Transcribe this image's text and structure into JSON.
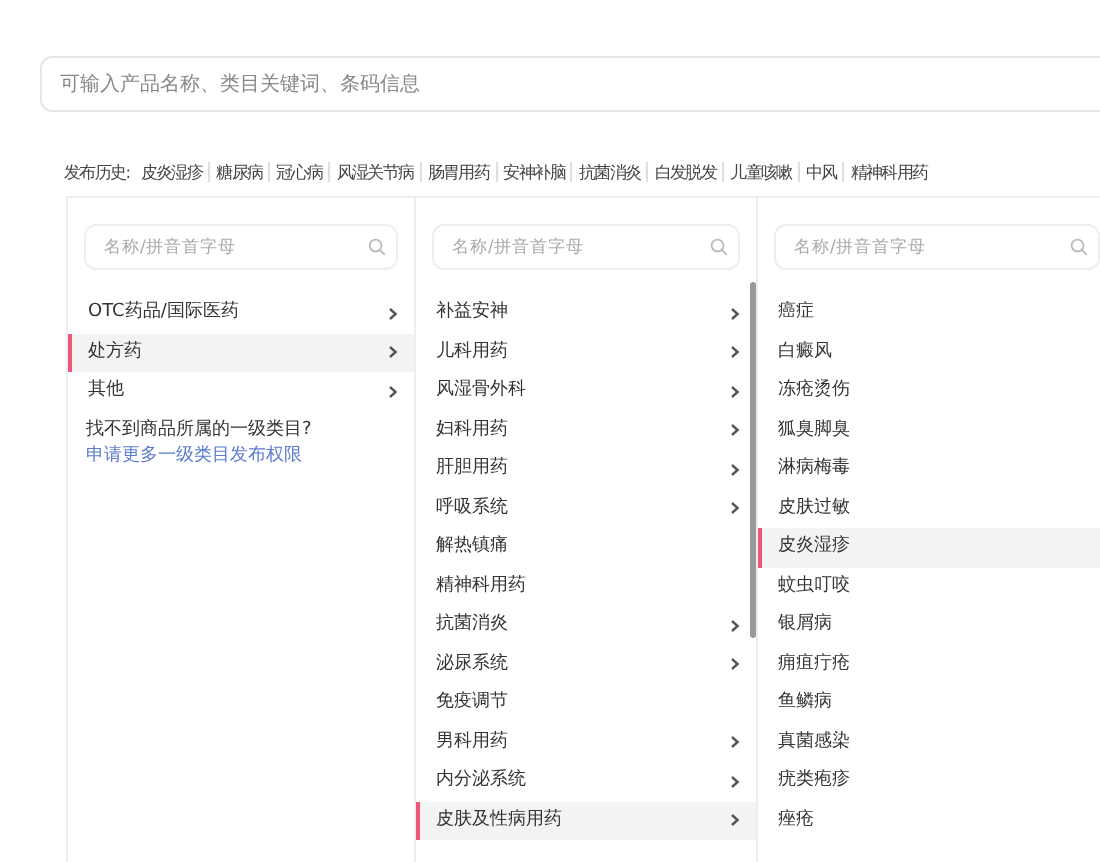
{
  "search": {
    "placeholder": "可输入产品名称、类目关键词、条码信息"
  },
  "history": {
    "label": "发布历史:",
    "items": [
      "皮炎湿疹",
      "糖尿病",
      "冠心病",
      "风湿关节病",
      "肠胃用药",
      "安神补脑",
      "抗菌消炎",
      "白发脱发",
      "儿童咳嗽",
      "中风",
      "精神科用药"
    ]
  },
  "columns": [
    {
      "placeholder": "名称/拼音首字母",
      "items": [
        {
          "label": "OTC药品/国际医药",
          "has_children": true,
          "selected": false
        },
        {
          "label": "处方药",
          "has_children": true,
          "selected": true
        },
        {
          "label": "其他",
          "has_children": true,
          "selected": false
        }
      ],
      "note": {
        "text": "找不到商品所属的一级类目?",
        "link": "申请更多一级类目发布权限"
      }
    },
    {
      "placeholder": "名称/拼音首字母",
      "items": [
        {
          "label": "补益安神",
          "has_children": true,
          "selected": false
        },
        {
          "label": "儿科用药",
          "has_children": true,
          "selected": false
        },
        {
          "label": "风湿骨外科",
          "has_children": true,
          "selected": false
        },
        {
          "label": "妇科用药",
          "has_children": true,
          "selected": false
        },
        {
          "label": "肝胆用药",
          "has_children": true,
          "selected": false
        },
        {
          "label": "呼吸系统",
          "has_children": true,
          "selected": false
        },
        {
          "label": "解热镇痛",
          "has_children": false,
          "selected": false
        },
        {
          "label": "精神科用药",
          "has_children": false,
          "selected": false
        },
        {
          "label": "抗菌消炎",
          "has_children": true,
          "selected": false
        },
        {
          "label": "泌尿系统",
          "has_children": true,
          "selected": false
        },
        {
          "label": "免疫调节",
          "has_children": false,
          "selected": false
        },
        {
          "label": "男科用药",
          "has_children": true,
          "selected": false
        },
        {
          "label": "内分泌系统",
          "has_children": true,
          "selected": false
        },
        {
          "label": "皮肤及性病用药",
          "has_children": true,
          "selected": true
        }
      ]
    },
    {
      "placeholder": "名称/拼音首字母",
      "items": [
        {
          "label": "癌症",
          "has_children": false,
          "selected": false
        },
        {
          "label": "白癜风",
          "has_children": false,
          "selected": false
        },
        {
          "label": "冻疮烫伤",
          "has_children": false,
          "selected": false
        },
        {
          "label": "狐臭脚臭",
          "has_children": false,
          "selected": false
        },
        {
          "label": "淋病梅毒",
          "has_children": false,
          "selected": false
        },
        {
          "label": "皮肤过敏",
          "has_children": false,
          "selected": false
        },
        {
          "label": "皮炎湿疹",
          "has_children": false,
          "selected": true
        },
        {
          "label": "蚊虫叮咬",
          "has_children": false,
          "selected": false
        },
        {
          "label": "银屑病",
          "has_children": false,
          "selected": false
        },
        {
          "label": "痈疽疔疮",
          "has_children": false,
          "selected": false
        },
        {
          "label": "鱼鳞病",
          "has_children": false,
          "selected": false
        },
        {
          "label": "真菌感染",
          "has_children": false,
          "selected": false
        },
        {
          "label": "疣类疱疹",
          "has_children": false,
          "selected": false
        },
        {
          "label": "痤疮",
          "has_children": false,
          "selected": false
        }
      ]
    }
  ]
}
